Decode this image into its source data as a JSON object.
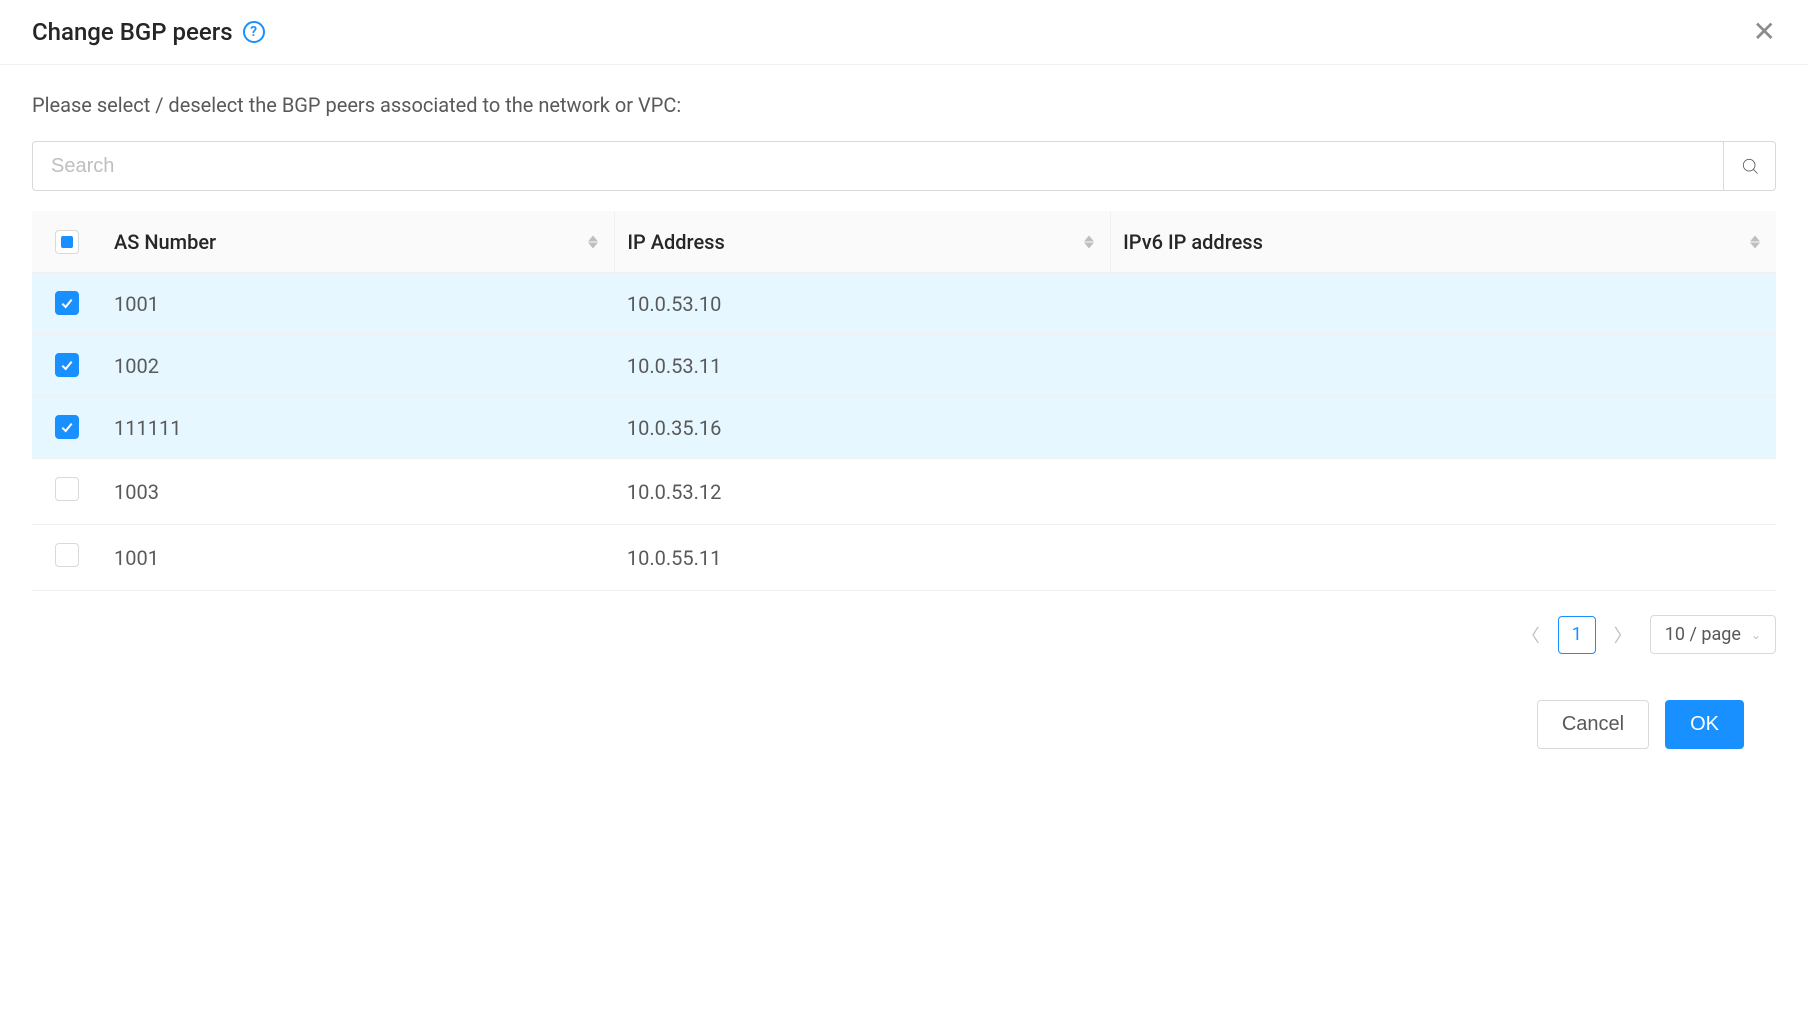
{
  "header": {
    "title": "Change BGP peers"
  },
  "instruction": "Please select / deselect the BGP peers associated to the network or VPC:",
  "search": {
    "placeholder": "Search"
  },
  "table": {
    "columns": {
      "as_number": "AS Number",
      "ip_address": "IP Address",
      "ipv6_address": "IPv6 IP address"
    },
    "rows": [
      {
        "selected": true,
        "as_number": "1001",
        "ip_address": "10.0.53.10",
        "ipv6_address": ""
      },
      {
        "selected": true,
        "as_number": "1002",
        "ip_address": "10.0.53.11",
        "ipv6_address": ""
      },
      {
        "selected": true,
        "as_number": "111111",
        "ip_address": "10.0.35.16",
        "ipv6_address": ""
      },
      {
        "selected": false,
        "as_number": "1003",
        "ip_address": "10.0.53.12",
        "ipv6_address": ""
      },
      {
        "selected": false,
        "as_number": "1001",
        "ip_address": "10.0.55.11",
        "ipv6_address": ""
      }
    ]
  },
  "pagination": {
    "current_page": "1",
    "page_size_label": "10 / page"
  },
  "footer": {
    "cancel": "Cancel",
    "ok": "OK"
  }
}
